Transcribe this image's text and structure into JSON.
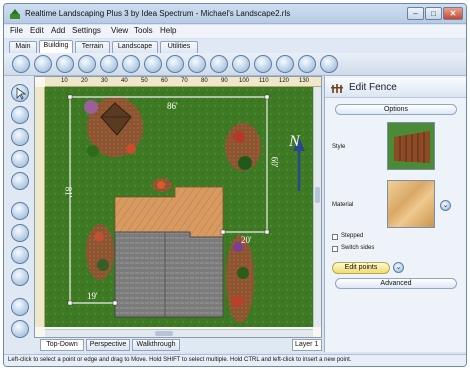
{
  "window": {
    "title": "Realtime Landscaping Plus 3 by Idea Spectrum - Michael's Landscape2.rls"
  },
  "menu": {
    "items": [
      "File",
      "Edit",
      "Add",
      "Settings",
      "View",
      "Tools",
      "Help"
    ]
  },
  "main_tabs": {
    "items": [
      "Main",
      "Building",
      "Terrain",
      "Landscape",
      "Utilities"
    ],
    "active": "Building"
  },
  "ruler": {
    "top_labels": [
      "10",
      "20",
      "30",
      "40",
      "50",
      "60",
      "70",
      "80",
      "90",
      "100",
      "110",
      "120",
      "130"
    ]
  },
  "plan": {
    "dimensions": {
      "top": "86'",
      "right": "60'",
      "left": "81'",
      "bottom_right": "20'",
      "bottom_left": "19'"
    },
    "north_label": "N",
    "colors": {
      "lawn": "#3e7a24",
      "deck": "#d99a62",
      "roof": "#7b7b7b",
      "mulch": "#8c5431",
      "fence": "#eeeeee"
    }
  },
  "view_tabs": {
    "items": [
      "Top-Down",
      "Perspective",
      "Walkthrough"
    ],
    "active": "Top-Down"
  },
  "layer_select": {
    "value": "Layer 1"
  },
  "panel": {
    "title": "Edit Fence",
    "options_label": "Options",
    "style_label": "Style",
    "material_label": "Material",
    "stepped_label": "Stepped",
    "switch_sides_label": "Switch sides",
    "edit_points_label": "Edit points",
    "advanced_label": "Advanced"
  },
  "status": {
    "text": "Left-click to select a point or edge and drag to Move. Hold SHIFT to select multiple. Hold CTRL and left-click to insert a new point."
  }
}
